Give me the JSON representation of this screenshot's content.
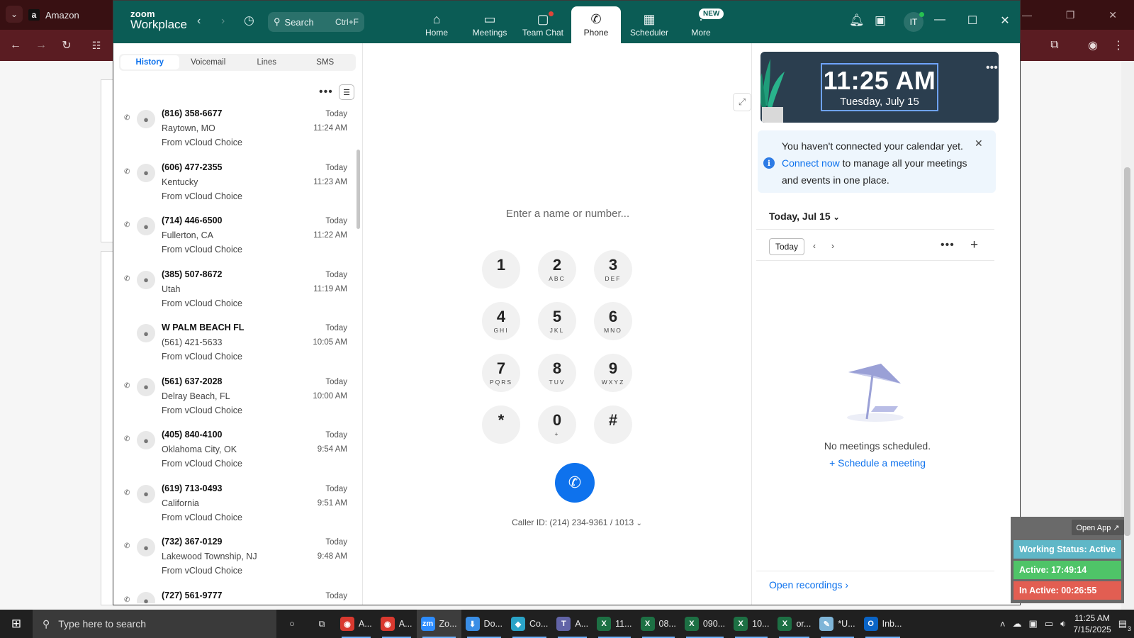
{
  "browser": {
    "tab_title": "Amazon",
    "tab_icon": "a"
  },
  "zoom": {
    "logo_top": "zoom",
    "logo_bottom": "Workplace",
    "search_placeholder": "Search",
    "search_shortcut": "Ctrl+F",
    "nav": [
      {
        "label": "Home",
        "icon": "home-icon"
      },
      {
        "label": "Meetings",
        "icon": "video-icon"
      },
      {
        "label": "Team Chat",
        "icon": "chat-icon"
      },
      {
        "label": "Phone",
        "icon": "phone-icon"
      },
      {
        "label": "Scheduler",
        "icon": "calendar-icon"
      },
      {
        "label": "More",
        "icon": "more-icon"
      }
    ],
    "new_badge": "NEW",
    "avatar_initials": "IT"
  },
  "history": {
    "tabs": [
      "History",
      "Voicemail",
      "Lines",
      "SMS"
    ],
    "active_tab": "History",
    "calls": [
      {
        "title": "(816) 358-6677",
        "line2": "Raytown, MO",
        "line3": "From vCloud Choice",
        "date": "Today",
        "time": "11:24 AM",
        "icon": true
      },
      {
        "title": "(606) 477-2355",
        "line2": "Kentucky",
        "line3": "From vCloud Choice",
        "date": "Today",
        "time": "11:23 AM",
        "icon": true
      },
      {
        "title": "(714) 446-6500",
        "line2": "Fullerton, CA",
        "line3": "From vCloud Choice",
        "date": "Today",
        "time": "11:22 AM",
        "icon": true
      },
      {
        "title": "(385) 507-8672",
        "line2": "Utah",
        "line3": "From vCloud Choice",
        "date": "Today",
        "time": "11:19 AM",
        "icon": true
      },
      {
        "title": "W PALM BEACH FL",
        "line2": "(561) 421-5633",
        "line3": "From vCloud Choice",
        "date": "Today",
        "time": "10:05 AM",
        "icon": false
      },
      {
        "title": "(561) 637-2028",
        "line2": "Delray Beach, FL",
        "line3": "From vCloud Choice",
        "date": "Today",
        "time": "10:00 AM",
        "icon": true
      },
      {
        "title": "(405) 840-4100",
        "line2": "Oklahoma City, OK",
        "line3": "From vCloud Choice",
        "date": "Today",
        "time": "9:54 AM",
        "icon": true
      },
      {
        "title": "(619) 713-0493",
        "line2": "California",
        "line3": "From vCloud Choice",
        "date": "Today",
        "time": "9:51 AM",
        "icon": true
      },
      {
        "title": "(732) 367-0129",
        "line2": "Lakewood Township, NJ",
        "line3": "From vCloud Choice",
        "date": "Today",
        "time": "9:48 AM",
        "icon": true
      },
      {
        "title": "(727) 561-9777",
        "line2": "",
        "line3": "",
        "date": "Today",
        "time": "",
        "icon": true
      }
    ]
  },
  "dialpad": {
    "placeholder": "Enter a name or number...",
    "keys": [
      {
        "n": "1",
        "l": ""
      },
      {
        "n": "2",
        "l": "ABC"
      },
      {
        "n": "3",
        "l": "DEF"
      },
      {
        "n": "4",
        "l": "GHI"
      },
      {
        "n": "5",
        "l": "JKL"
      },
      {
        "n": "6",
        "l": "MNO"
      },
      {
        "n": "7",
        "l": "PQRS"
      },
      {
        "n": "8",
        "l": "TUV"
      },
      {
        "n": "9",
        "l": "WXYZ"
      },
      {
        "n": "*",
        "l": ""
      },
      {
        "n": "0",
        "l": "+"
      },
      {
        "n": "#",
        "l": ""
      }
    ],
    "caller_id": "Caller ID: (214) 234-9361 / 1013"
  },
  "calendar": {
    "clock_time": "11:25 AM",
    "clock_date": "Tuesday, July 15",
    "notice_before": "You haven't connected your calendar yet. ",
    "notice_link": "Connect now",
    "notice_after": " to manage all your meetings and events in one place.",
    "day_title": "Today, Jul 15",
    "today_button": "Today",
    "empty_text": "No meetings scheduled.",
    "schedule_link": "Schedule a meeting",
    "open_recordings": "Open recordings"
  },
  "status_widget": {
    "open_app": "Open App ↗",
    "working": "Working Status: Active",
    "active": "Active: 17:49:14",
    "inactive": "In Active: 00:26:55",
    "colors": {
      "working": "#5fb7c7",
      "active": "#4fc468",
      "inactive": "#e25e52"
    }
  },
  "taskbar": {
    "search_placeholder": "Type here to search",
    "items": [
      {
        "label": "A...",
        "icon": "chrome-icon",
        "color": "#d9392f"
      },
      {
        "label": "A...",
        "icon": "chrome-icon",
        "color": "#d9392f"
      },
      {
        "label": "Zo...",
        "icon": "zoom-icon",
        "color": "#2d8cff",
        "active": true
      },
      {
        "label": "Do...",
        "icon": "download-icon",
        "color": "#3a8ee6"
      },
      {
        "label": "Co...",
        "icon": "app-icon",
        "color": "#2aa3c7"
      },
      {
        "label": "A...",
        "icon": "teams-icon",
        "color": "#6264a7"
      },
      {
        "label": "11...",
        "icon": "excel-icon",
        "color": "#1d7044"
      },
      {
        "label": "08...",
        "icon": "excel-icon",
        "color": "#1d7044"
      },
      {
        "label": "090...",
        "icon": "excel-icon",
        "color": "#1d7044"
      },
      {
        "label": "10...",
        "icon": "excel-icon",
        "color": "#1d7044"
      },
      {
        "label": "or...",
        "icon": "excel-icon",
        "color": "#1d7044"
      },
      {
        "label": "*U...",
        "icon": "notepad-icon",
        "color": "#7fb5d8"
      },
      {
        "label": "Inb...",
        "icon": "outlook-icon",
        "color": "#0a64c6"
      }
    ],
    "time": "11:25 AM",
    "date": "7/15/2025",
    "notif_count": "3"
  }
}
